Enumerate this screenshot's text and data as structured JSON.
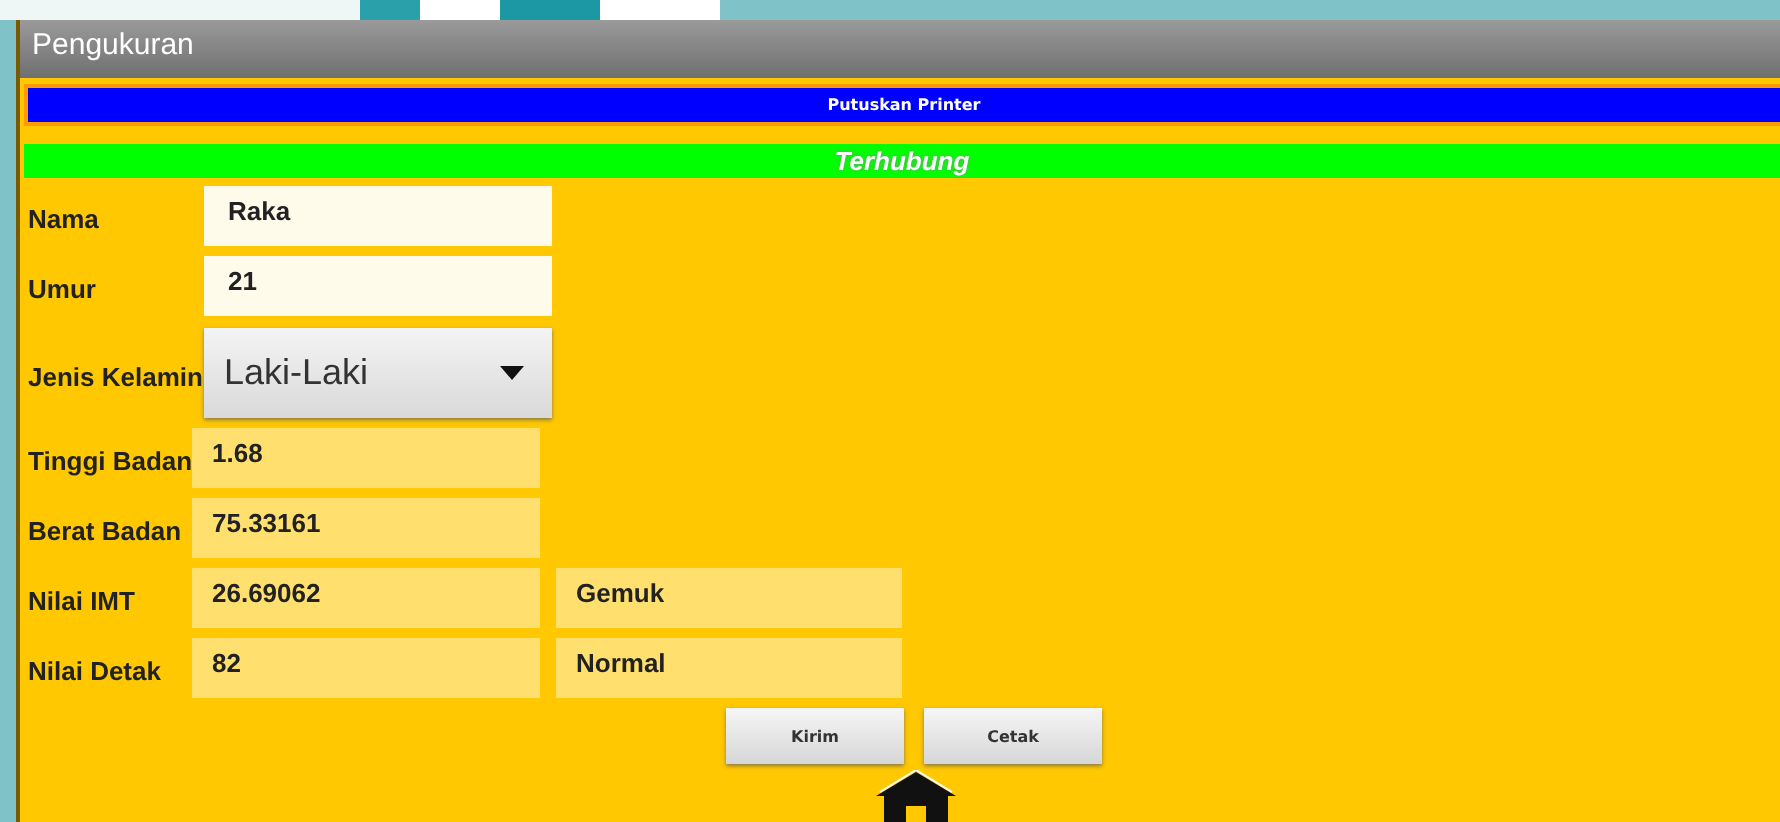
{
  "window": {
    "title": "Pengukuran"
  },
  "printer_button": {
    "label": "Putuskan Printer"
  },
  "status": {
    "text": "Terhubung"
  },
  "fields": [
    {
      "kind": "input",
      "label": "Nama",
      "value": "Raka"
    },
    {
      "kind": "input",
      "label": "Umur",
      "value": "21"
    },
    {
      "kind": "dropdown",
      "label": "Jenis Kelamin",
      "value": "Laki-Laki"
    },
    {
      "kind": "readout",
      "label": "Tinggi Badan",
      "value": "1.68"
    },
    {
      "kind": "readout",
      "label": "Berat Badan",
      "value": "75.33161"
    },
    {
      "kind": "readout",
      "label": "Nilai IMT",
      "value": "26.69062",
      "category": "Gemuk"
    },
    {
      "kind": "readout",
      "label": "Nilai Detak",
      "value": "82",
      "category": "Normal"
    }
  ],
  "buttons": [
    "Kirim",
    "Cetak"
  ]
}
